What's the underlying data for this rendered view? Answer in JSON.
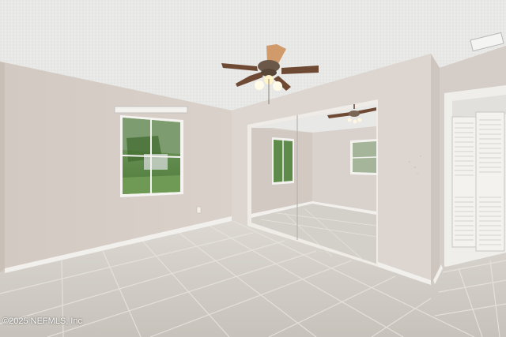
{
  "photo": {
    "subject": "empty-bedroom",
    "watermark": "©2025 NEFMLS, Inc"
  },
  "colors": {
    "ceiling": "#e9e9e7",
    "wall": "#d8d0c9",
    "wall_right": "#dcd6d1",
    "floor": "#cfcac3",
    "baseboard": "#f2f0ec",
    "fan_blade": "#6e4a34",
    "window_green": "#5f8c4a"
  }
}
